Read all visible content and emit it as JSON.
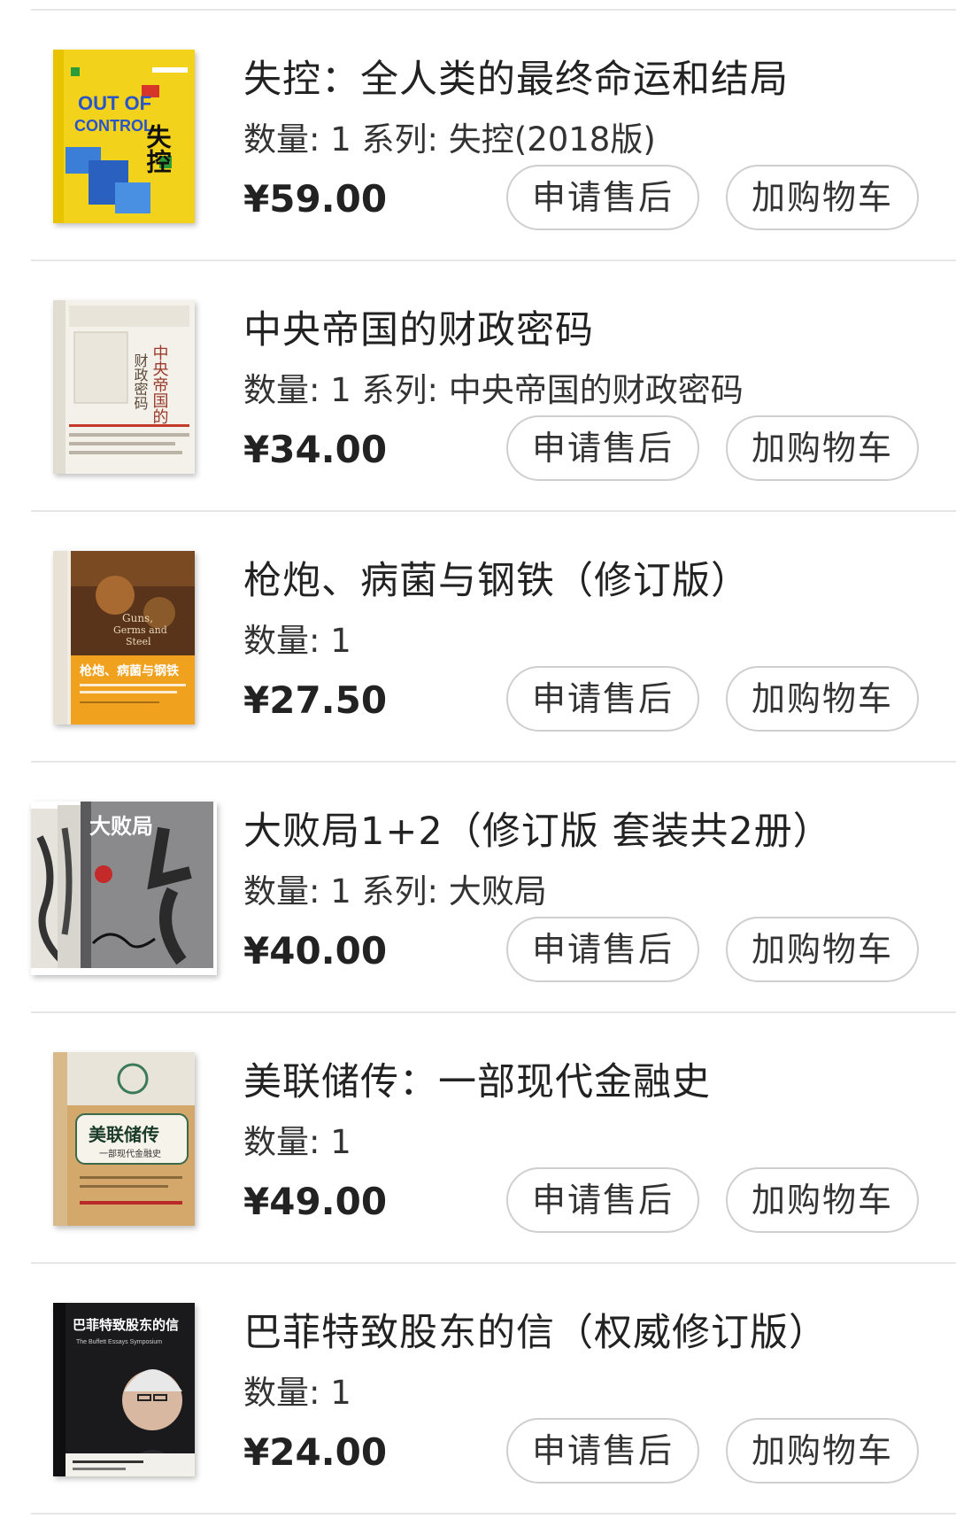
{
  "orders": [
    {
      "title": "失控：全人类的最终命运和结局",
      "meta": "数量: 1 系列: 失控(2018版)",
      "price": "¥59.00",
      "cover_text": [
        "OUT OF",
        "CONTROL",
        "失控"
      ]
    },
    {
      "title": "中央帝国的财政密码",
      "meta": "数量: 1 系列: 中央帝国的财政密码",
      "price": "¥34.00",
      "cover_text": [
        "中央帝国的",
        "财政密码"
      ]
    },
    {
      "title": "枪炮、病菌与钢铁（修订版）",
      "meta": "数量: 1",
      "price": "¥27.50",
      "cover_text": [
        "Guns,",
        "Germs and",
        "Steel",
        "枪炮、病菌与钢铁"
      ]
    },
    {
      "title": "大败局1+2（修订版 套装共2册）",
      "meta": "数量: 1 系列: 大败局",
      "price": "¥40.00",
      "cover_text": [
        "大败局"
      ]
    },
    {
      "title": "美联储传：一部现代金融史",
      "meta": "数量: 1",
      "price": "¥49.00",
      "cover_text": [
        "美联储传",
        "一部现代金融史"
      ]
    },
    {
      "title": "巴菲特致股东的信（权威修订版）",
      "meta": "数量: 1",
      "price": "¥24.00",
      "cover_text": [
        "巴菲特致股东的信",
        "The Buffett Essays Symposium"
      ]
    }
  ],
  "buttons": {
    "after_sale": "申请售后",
    "add_to_cart": "加购物车"
  },
  "colors": {
    "divider": "#e6e6e6",
    "button_border": "#cfcfcf",
    "text": "#222222"
  }
}
